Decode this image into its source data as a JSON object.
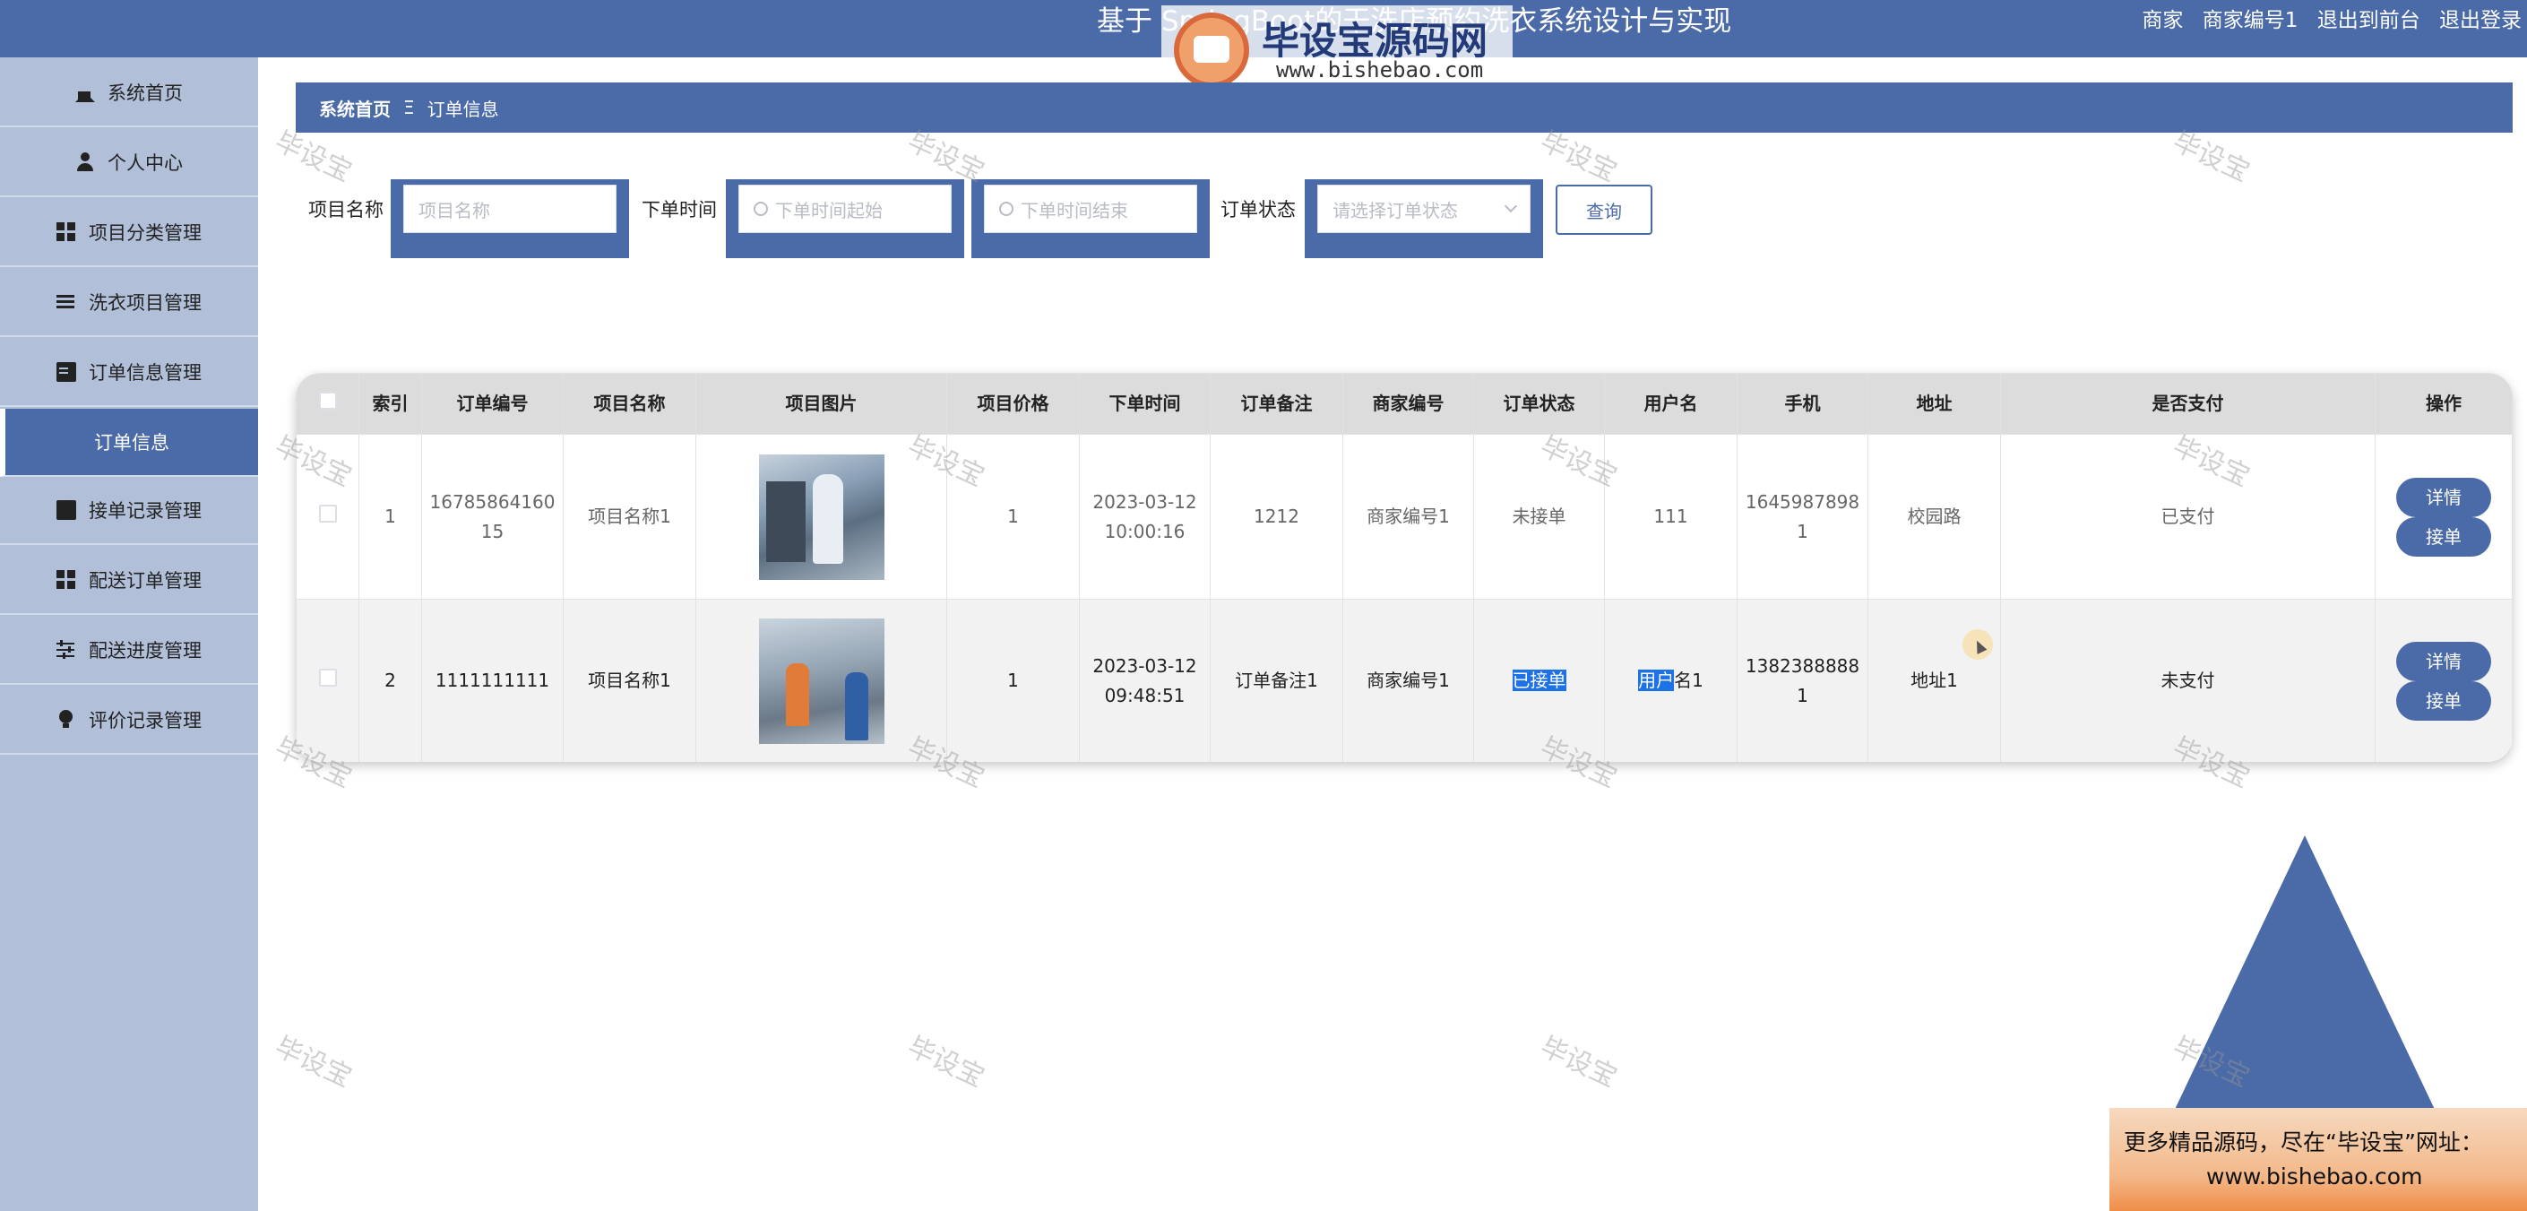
{
  "header": {
    "title": "基于 SpringBoot的干洗店预约洗衣系统设计与实现",
    "user_role": "商家",
    "user_name": "商家编号1",
    "back_to_front": "退出到前台",
    "logout": "退出登录"
  },
  "logo_watermark": {
    "main": "毕设宝源码网",
    "url": "www.bishebao.com"
  },
  "sidebar": {
    "items": [
      {
        "label": "系统首页",
        "icon": "home-icon"
      },
      {
        "label": "个人中心",
        "icon": "user-icon"
      },
      {
        "label": "项目分类管理",
        "icon": "grid-icon"
      },
      {
        "label": "洗衣项目管理",
        "icon": "list-icon"
      },
      {
        "label": "订单信息管理",
        "icon": "clipboard-icon"
      },
      {
        "label": "订单信息",
        "active": true
      },
      {
        "label": "接单记录管理",
        "icon": "book-icon"
      },
      {
        "label": "配送订单管理",
        "icon": "grid-icon"
      },
      {
        "label": "配送进度管理",
        "icon": "sliders-icon"
      },
      {
        "label": "评价记录管理",
        "icon": "bulb-icon"
      }
    ]
  },
  "breadcrumb": {
    "home": "系统首页",
    "separator": "Ξ",
    "current": "订单信息"
  },
  "search": {
    "project_name_label": "项目名称",
    "project_name_placeholder": "项目名称",
    "order_time_label": "下单时间",
    "order_time_start_placeholder": "下单时间起始",
    "order_time_end_placeholder": "下单时间结束",
    "order_status_label": "订单状态",
    "order_status_placeholder": "请选择订单状态",
    "query_button": "查询"
  },
  "table": {
    "columns": [
      "索引",
      "订单编号",
      "项目名称",
      "项目图片",
      "项目价格",
      "下单时间",
      "订单备注",
      "商家编号",
      "订单状态",
      "用户名",
      "手机",
      "地址",
      "是否支付",
      "操作"
    ],
    "rows": [
      {
        "index": "1",
        "order_no": "1678586416015",
        "project_name": "项目名称1",
        "price": "1",
        "order_time": "2023-03-12 10:00:16",
        "remark": "1212",
        "merchant_no": "商家编号1",
        "status": "未接单",
        "username": "111",
        "phone": "16459878981",
        "address": "校园路",
        "paid": "已支付",
        "detail_button": "详情",
        "accept_button": "接单"
      },
      {
        "index": "2",
        "order_no": "1111111111",
        "project_name": "项目名称1",
        "price": "1",
        "order_time": "2023-03-12 09:48:51",
        "remark": "订单备注1",
        "merchant_no": "商家编号1",
        "status": "已接单",
        "username_highlight": "用户",
        "username_rest": "名1",
        "phone": "13823888881",
        "address": "地址1",
        "paid": "未支付",
        "detail_button": "详情",
        "accept_button": "接单"
      }
    ]
  },
  "watermark_text": "毕设宝",
  "ad": {
    "line1": "更多精品源码，尽在“毕设宝”网址：",
    "line2": "www.bishebao.com"
  },
  "colors": {
    "primary": "#4a6aa8",
    "sidebar_bg": "#b1bfd9",
    "highlight": "#1e72e8"
  }
}
